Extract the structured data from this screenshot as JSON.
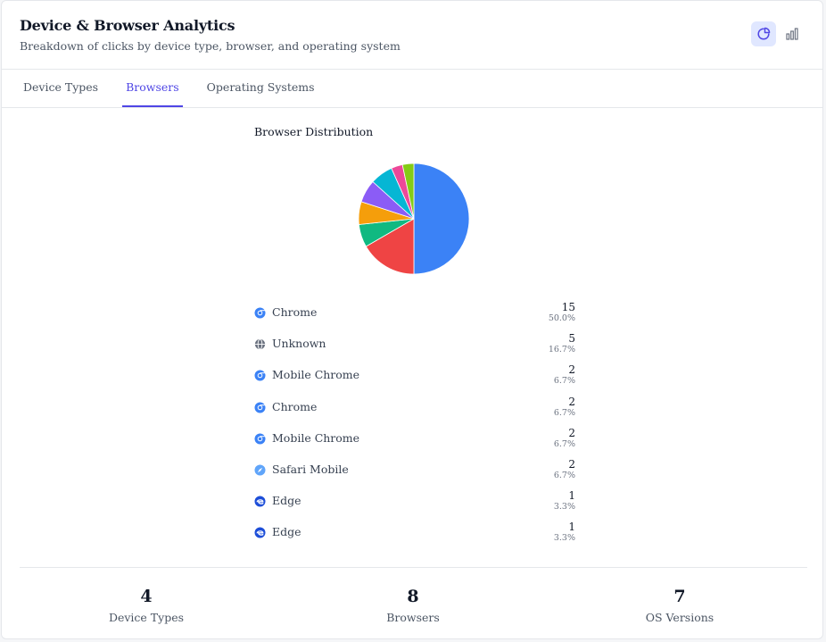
{
  "header": {
    "title": "Device & Browser Analytics",
    "subtitle": "Breakdown of clicks by device type, browser, and operating system"
  },
  "view_toggle": [
    {
      "icon": "pie-chart-icon",
      "active": true
    },
    {
      "icon": "bar-chart-icon",
      "active": false
    }
  ],
  "tabs": [
    {
      "label": "Device Types",
      "active": false
    },
    {
      "label": "Browsers",
      "active": true
    },
    {
      "label": "Operating Systems",
      "active": false
    }
  ],
  "chart_data": {
    "type": "pie",
    "title": "Browser Distribution",
    "categories": [
      "Chrome",
      "Unknown",
      "Mobile Chrome",
      "Chrome",
      "Mobile Chrome",
      "Safari Mobile",
      "Edge",
      "Edge"
    ],
    "values": [
      15,
      5,
      2,
      2,
      2,
      2,
      1,
      1
    ],
    "colors": [
      "#3b82f6",
      "#ef4444",
      "#10b981",
      "#f59e0b",
      "#8b5cf6",
      "#06b6d4",
      "#ec4899",
      "#84cc16"
    ]
  },
  "legend": [
    {
      "label": "Chrome",
      "count": "15",
      "pct": "50.0%",
      "icon": "chrome-icon"
    },
    {
      "label": "Unknown",
      "count": "5",
      "pct": "16.7%",
      "icon": "globe-icon"
    },
    {
      "label": "Mobile Chrome",
      "count": "2",
      "pct": "6.7%",
      "icon": "chrome-icon"
    },
    {
      "label": "Chrome",
      "count": "2",
      "pct": "6.7%",
      "icon": "chrome-icon"
    },
    {
      "label": "Mobile Chrome",
      "count": "2",
      "pct": "6.7%",
      "icon": "chrome-icon"
    },
    {
      "label": "Safari Mobile",
      "count": "2",
      "pct": "6.7%",
      "icon": "safari-icon"
    },
    {
      "label": "Edge",
      "count": "1",
      "pct": "3.3%",
      "icon": "edge-icon"
    },
    {
      "label": "Edge",
      "count": "1",
      "pct": "3.3%",
      "icon": "edge-icon"
    }
  ],
  "stats": [
    {
      "value": "4",
      "label": "Device Types"
    },
    {
      "value": "8",
      "label": "Browsers"
    },
    {
      "value": "7",
      "label": "OS Versions"
    }
  ]
}
